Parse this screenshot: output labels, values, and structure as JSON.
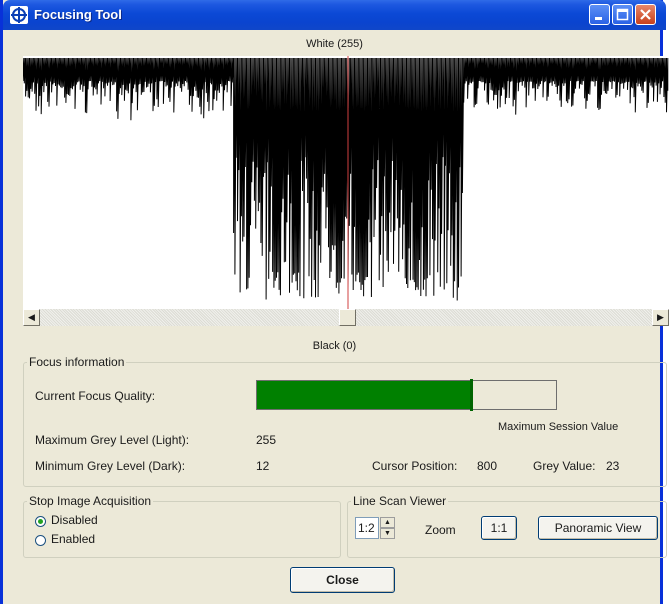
{
  "window": {
    "title": "Focusing Tool",
    "icon": "crosshair-icon"
  },
  "title_buttons": [
    "minimize-icon",
    "maximize-icon",
    "close-icon"
  ],
  "scan": {
    "top_label": "White (255)",
    "bottom_label": "Black (0)",
    "cursor_color": "#d04040",
    "signal_color": "#000000"
  },
  "scrollbar": {
    "left_arrow": "◀",
    "right_arrow": "▶"
  },
  "focus": {
    "legend": "Focus information",
    "quality_label": "Current Focus Quality:",
    "quality_fraction": 0.72,
    "max_session_fraction": 0.72,
    "bar_color": "#008000",
    "max_session_label": "Maximum Session Value",
    "max_grey_label": "Maximum Grey Level (Light):",
    "max_grey_value": "255",
    "min_grey_label": "Minimum Grey Level (Dark):",
    "min_grey_value": "12",
    "cursor_label": "Cursor Position:",
    "cursor_value": "800",
    "grey_label": "Grey Value:",
    "grey_value": "23"
  },
  "acquisition": {
    "legend": "Stop Image Acquisition",
    "options": [
      "Disabled",
      "Enabled"
    ],
    "selected": "Disabled"
  },
  "linescan": {
    "legend": "Line Scan Viewer",
    "zoom_value": "1:2",
    "zoom_label": "Zoom",
    "one_to_one": "1:1",
    "panoramic": "Panoramic View"
  },
  "close_button": "Close"
}
